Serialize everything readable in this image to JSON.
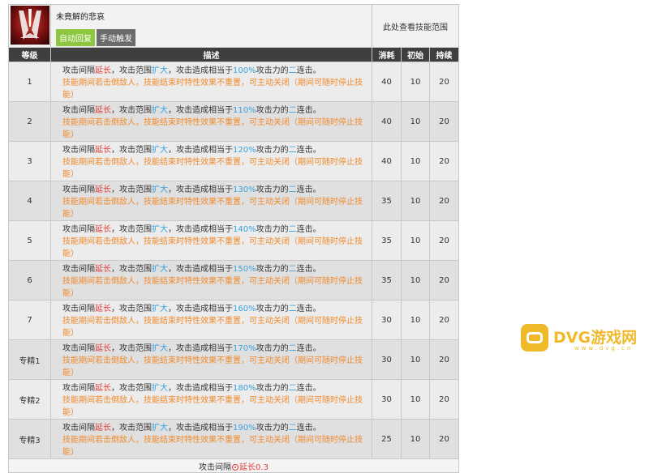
{
  "skill": {
    "name": "未竟解的悲哀",
    "tag_auto": "自动回复",
    "tag_manual": "手动触发",
    "range_hint": "此处查看技能范围"
  },
  "columns": {
    "level": "等级",
    "desc": "描述",
    "cost": "消耗",
    "initial": "初始",
    "duration": "持续"
  },
  "desc_parts": {
    "p1": "攻击间隔",
    "extend": "延长",
    "p2": "，攻击范围",
    "expand": "扩大",
    "p3": "，攻击造成相当于",
    "p4": "攻击力的",
    "two": "二",
    "p5": "连击。",
    "line2a": "技能期间若击倒敌人，技能结束时特性效果不重置，可主动关闭（",
    "line2b": "期间可随时停止技能",
    "line2c": "）"
  },
  "rows": [
    {
      "level": "1",
      "pct": "100%",
      "cost": "40",
      "initial": "10",
      "duration": "20"
    },
    {
      "level": "2",
      "pct": "110%",
      "cost": "40",
      "initial": "10",
      "duration": "20"
    },
    {
      "level": "3",
      "pct": "120%",
      "cost": "40",
      "initial": "10",
      "duration": "20"
    },
    {
      "level": "4",
      "pct": "130%",
      "cost": "35",
      "initial": "10",
      "duration": "20"
    },
    {
      "level": "5",
      "pct": "140%",
      "cost": "35",
      "initial": "10",
      "duration": "20"
    },
    {
      "level": "6",
      "pct": "150%",
      "cost": "35",
      "initial": "10",
      "duration": "20"
    },
    {
      "level": "7",
      "pct": "160%",
      "cost": "30",
      "initial": "10",
      "duration": "20"
    },
    {
      "level": "专精1",
      "pct": "170%",
      "cost": "30",
      "initial": "10",
      "duration": "20"
    },
    {
      "level": "专精2",
      "pct": "180%",
      "cost": "30",
      "initial": "10",
      "duration": "20"
    },
    {
      "level": "专精3",
      "pct": "190%",
      "cost": "25",
      "initial": "10",
      "duration": "20"
    }
  ],
  "footer": {
    "label": "攻击间隔",
    "extend": "延长0.3"
  },
  "watermark": {
    "text": "DVG游戏网",
    "sub": "www.dvg.cn"
  },
  "colors": {
    "header_bg": "#3f3f3f",
    "red": "#e23c3c",
    "blue": "#3aa0e0",
    "orange": "#f08a2c",
    "green_tag": "#8dc73f",
    "gray_tag": "#6b6b6b",
    "watermark": "#f0b92a"
  }
}
